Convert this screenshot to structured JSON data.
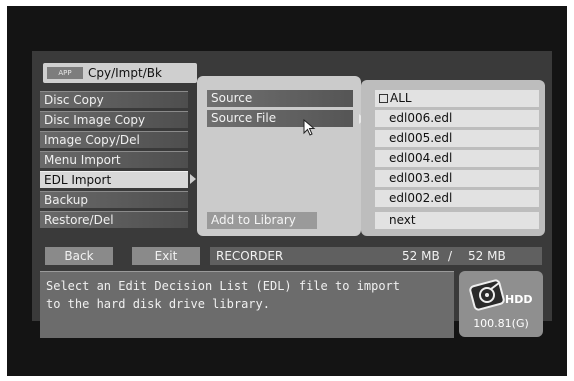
{
  "app": {
    "badge": "APP",
    "title": "Cpy/Impt/Bk"
  },
  "menu": {
    "items": [
      {
        "label": "Disc Copy"
      },
      {
        "label": "Disc Image Copy"
      },
      {
        "label": "Image Copy/Del"
      },
      {
        "label": "Menu Import"
      },
      {
        "label": "EDL Import",
        "selected": true
      },
      {
        "label": "Backup"
      },
      {
        "label": "Restore/Del"
      }
    ]
  },
  "options": {
    "source": "Source",
    "source_file": "Source File",
    "add_to_library": "Add to Library"
  },
  "files": {
    "items": [
      {
        "label": "ALL",
        "checked": false
      },
      {
        "label": "edl006.edl"
      },
      {
        "label": "edl005.edl"
      },
      {
        "label": "edl004.edl"
      },
      {
        "label": "edl003.edl"
      },
      {
        "label": "edl002.edl"
      },
      {
        "label": "next"
      }
    ]
  },
  "footer": {
    "back": "Back",
    "exit": "Exit",
    "recorder": "RECORDER",
    "used": "52 MB",
    "separator": "/",
    "total": "52 MB"
  },
  "message": {
    "line1": "Select an Edit Decision List (EDL) file to import",
    "line2": "to the hard disk drive library."
  },
  "hdd": {
    "label": "HDD",
    "size": "100.81(G)"
  },
  "colors": {
    "screen_bg": "#141414",
    "panel_light": "#cbcbcb",
    "menu_selected": "#d8d8d8",
    "menu_item": "#5a5a5a"
  },
  "icons": {
    "pointer": "arrow-right-icon",
    "cursor": "mouse-cursor-icon",
    "checkbox": "checkbox-icon",
    "hdd": "hard-disk-icon"
  }
}
